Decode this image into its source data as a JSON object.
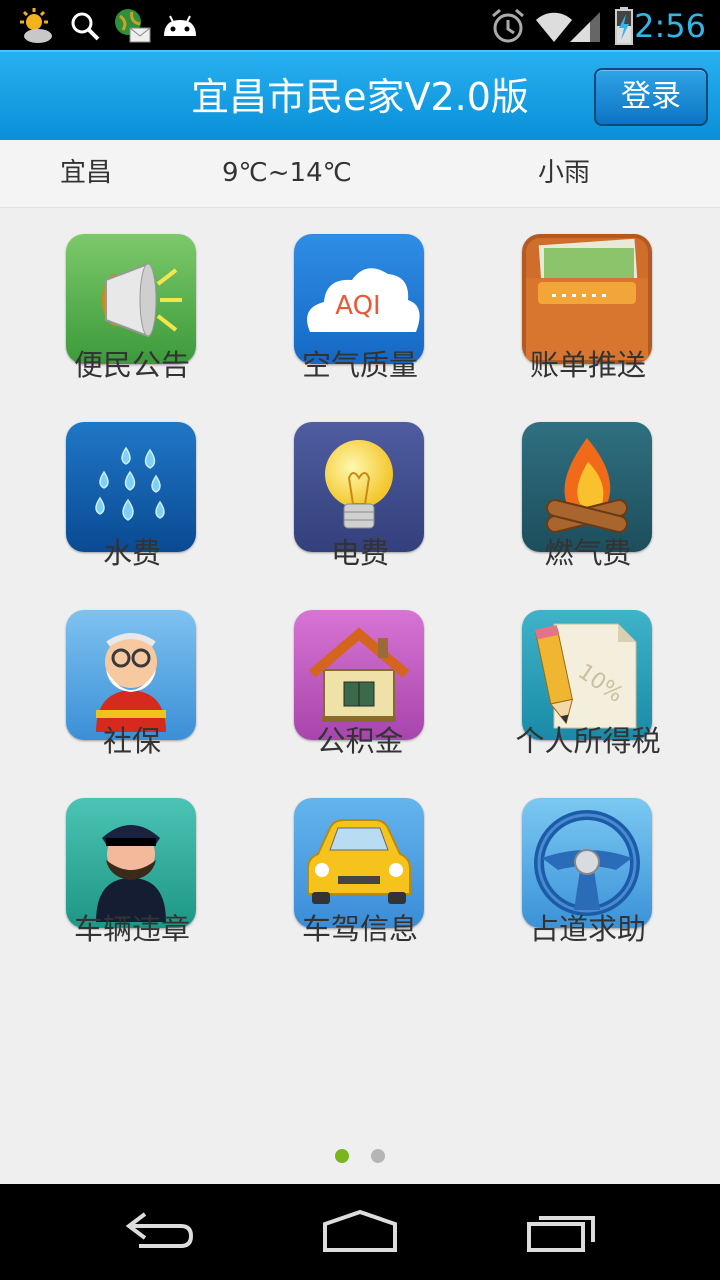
{
  "status_bar": {
    "time": "2:56",
    "left_icons": [
      "weather-sun-cloud-icon",
      "search-icon",
      "globe-mail-icon",
      "android-icon"
    ],
    "right_icons": [
      "alarm-icon",
      "wifi-icon",
      "signal-icon",
      "battery-charging-icon"
    ]
  },
  "header": {
    "title": "宜昌市民e家V2.0版",
    "login_label": "登录"
  },
  "weather": {
    "city": "宜昌",
    "temperature": "9℃~14℃",
    "condition": "小雨"
  },
  "grid": [
    {
      "label": "便民公告",
      "icon": "megaphone-icon"
    },
    {
      "label": "空气质量",
      "icon": "aqi-cloud-icon",
      "icon_text": "AQI"
    },
    {
      "label": "账单推送",
      "icon": "wallet-icon"
    },
    {
      "label": "水费",
      "icon": "water-drops-icon"
    },
    {
      "label": "电费",
      "icon": "lightbulb-icon"
    },
    {
      "label": "燃气费",
      "icon": "campfire-icon"
    },
    {
      "label": "社保",
      "icon": "elder-person-icon"
    },
    {
      "label": "公积金",
      "icon": "house-icon"
    },
    {
      "label": "个人所得税",
      "icon": "tax-pencil-icon",
      "icon_text": "10%"
    },
    {
      "label": "车辆违章",
      "icon": "police-officer-icon"
    },
    {
      "label": "车驾信息",
      "icon": "car-icon"
    },
    {
      "label": "占道求助",
      "icon": "steering-wheel-icon"
    }
  ],
  "pager": {
    "pages": 2,
    "active": 0
  },
  "colors": {
    "accent": "#1aa3e8",
    "active_dot": "#7ab51d",
    "inactive_dot": "#b5b5b5",
    "status_time": "#33b5e5"
  },
  "nav_bar": [
    "back-icon",
    "home-icon",
    "recent-apps-icon"
  ]
}
